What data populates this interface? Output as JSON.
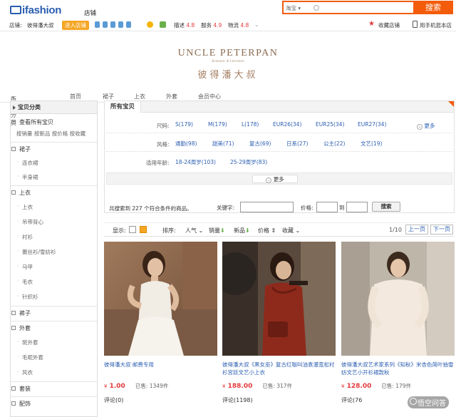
{
  "header": {
    "logo": "ifashion",
    "store_label": "店铺",
    "search": {
      "scope": "淘宝",
      "button": "搜索"
    }
  },
  "infobar": {
    "store_prefix": "店铺:",
    "store_name": "彼得潘大叔",
    "enter_store": "进入店铺",
    "ratings": [
      {
        "label": "描述",
        "score": "4.8"
      },
      {
        "label": "服务",
        "score": "4.9"
      },
      {
        "label": "物流",
        "score": "4.8"
      }
    ],
    "favorite": "收藏店铺",
    "mobile": "用手机逛本店"
  },
  "brand": {
    "en": "UNCLE PETERPAN",
    "sub": "Romantic & Literature",
    "cn": "彼得潘大叔"
  },
  "nav": [
    "所有分类",
    "首页",
    "裙子",
    "上衣",
    "外套",
    "会员中心"
  ],
  "sidebar": {
    "title": "宝贝分类",
    "view_all": "查看所有宝贝",
    "sort_links": [
      "按销量",
      "按新品",
      "按价格",
      "按收藏"
    ],
    "categories": [
      {
        "name": "裙子",
        "items": [
          "连衣裙",
          "半身裙"
        ]
      },
      {
        "name": "上衣",
        "items": [
          "上衣",
          "吊带背心",
          "衬衫",
          "蕾丝衫/雪纺衫",
          "马甲",
          "毛衣",
          "针织衫"
        ]
      },
      {
        "name": "裤子",
        "items": []
      },
      {
        "name": "外套",
        "items": [
          "斑外套",
          "毛呢外套",
          "风衣"
        ]
      },
      {
        "name": "套装",
        "items": []
      },
      {
        "name": "配饰",
        "items": []
      }
    ]
  },
  "filter": {
    "tab": "所有宝贝",
    "size_label": "尺码:",
    "sizes": [
      "S(179)",
      "M(179)",
      "L(178)",
      "EUR26(34)",
      "EUR25(34)",
      "EUR27(34)"
    ],
    "more": "更多",
    "style_label": "风格:",
    "styles": [
      "通勤(98)",
      "甜美(71)",
      "复古(69)",
      "日系(27)",
      "公主(22)",
      "文艺(19)"
    ],
    "age_label": "适用年龄:",
    "ages": [
      "18-24周岁(103)",
      "25-29周岁(83)"
    ],
    "expand": "更多",
    "result_text": "共搜索到 227 个符合条件的商品。",
    "keyword_label": "关键字:",
    "price_label": "价格:",
    "to": "到",
    "search_btn": "搜索"
  },
  "sortbar": {
    "show": "显示:",
    "sort": "排序:",
    "options": [
      "人气",
      "销量",
      "新品",
      "价格",
      "收藏"
    ],
    "page": "1/10",
    "prev": "上一页",
    "next": "下一页"
  },
  "products": [
    {
      "title": "彼得潘大叔 邮费专用",
      "currency": "¥",
      "price": "1.00",
      "sold_label": "已售:",
      "sold": "1349件",
      "comments_label": "评论",
      "comments": "(0)"
    },
    {
      "title": "彼得潘大叔《黑女巫》复古红咖叫油袁漫宽松衬衫宫廷文艺小上衣",
      "currency": "¥",
      "price": "188.00",
      "sold_label": "已售:",
      "sold": "317件",
      "comments_label": "评论",
      "comments": "(1198)"
    },
    {
      "title": "彼得潘大叔艺术家系列《知秋》米杏色简叶抽雪纺文艺小开衫裙款秋",
      "currency": "¥",
      "price": "128.00",
      "sold_label": "已售:",
      "sold": "179件",
      "comments_label": "评论",
      "comments": "(76"
    }
  ],
  "watermark": "悟空问答",
  "colors": {
    "accent": "#f35c0a",
    "link": "#2a5db0",
    "price": "#e4393c"
  }
}
